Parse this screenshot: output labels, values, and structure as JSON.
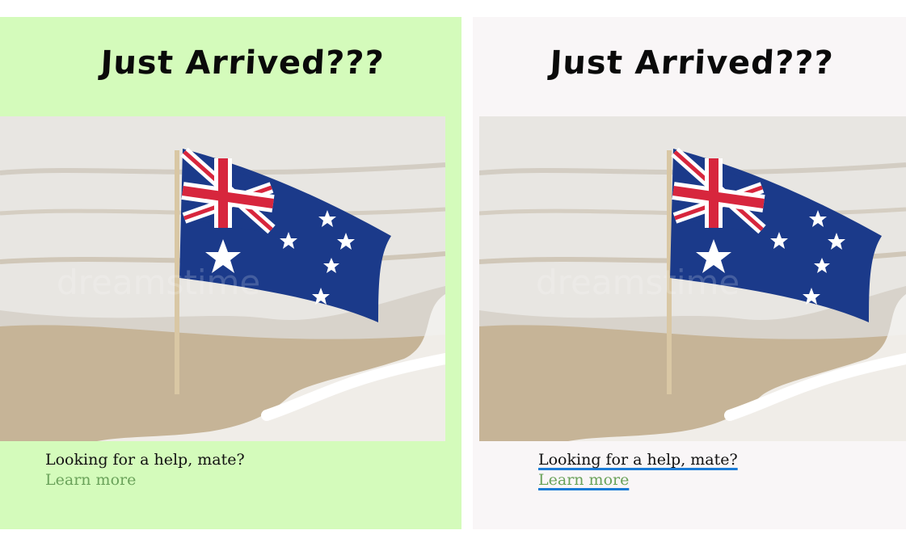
{
  "cards": [
    {
      "title": "Just Arrived???",
      "caption": "Looking for a help, mate?",
      "link_label": "Learn more",
      "image_alt": "Australian flag on a beach in the surf",
      "watermark": "dreamstime"
    },
    {
      "title": "Just Arrived???",
      "caption": "Looking for a help, mate?",
      "link_label": "Learn more",
      "image_alt": "Australian flag on a beach in the surf",
      "watermark": "dreamstime"
    }
  ],
  "colors": {
    "left_card_bg": "#d4fbbb",
    "right_card_bg": "#f9f6f7",
    "link": "#6aa25a",
    "focus_underline": "#1a7bd6",
    "flag_blue": "#1b3a8a",
    "flag_red": "#d7263d"
  }
}
